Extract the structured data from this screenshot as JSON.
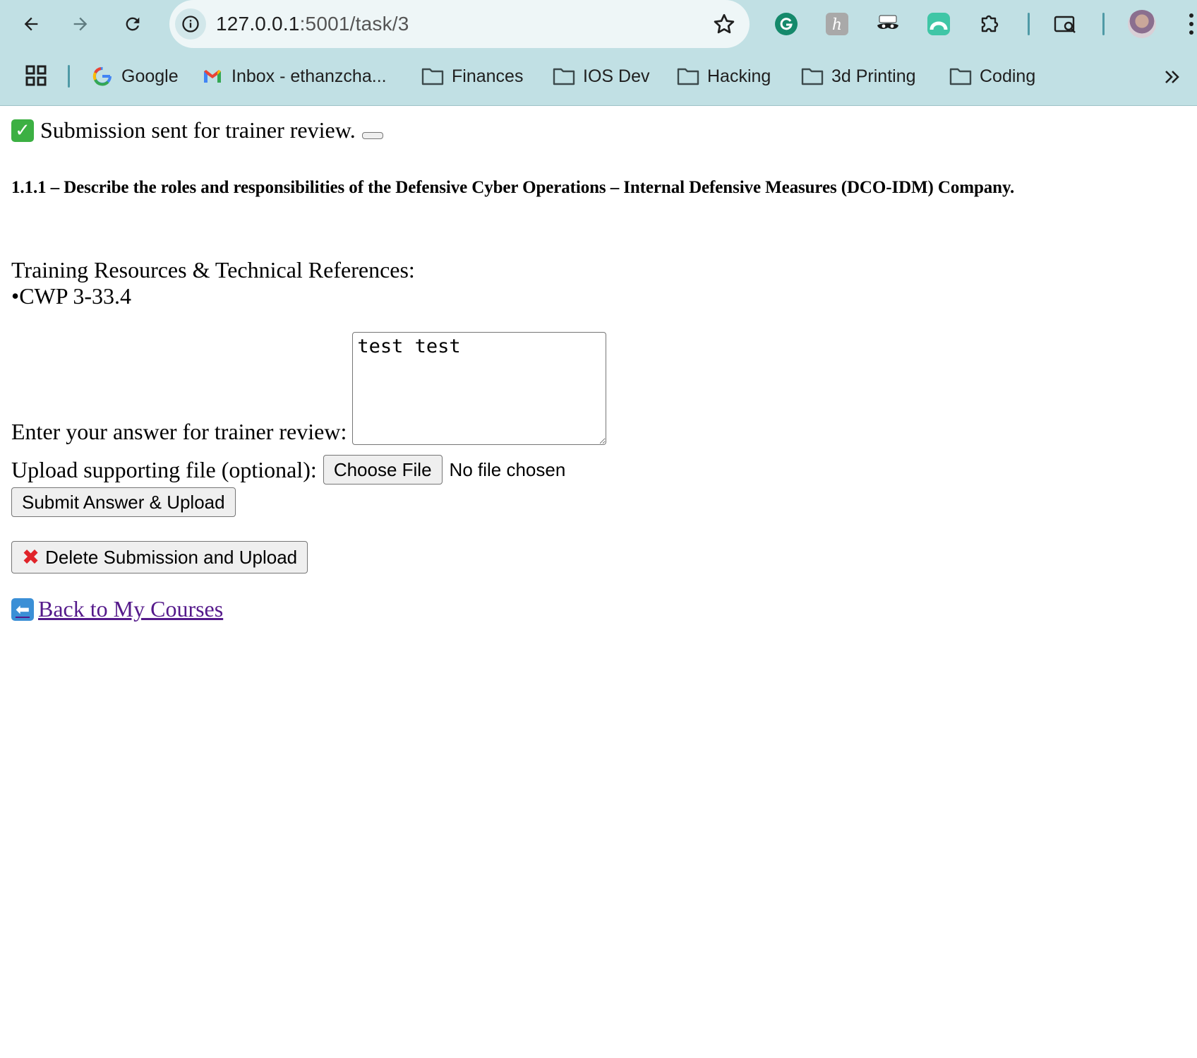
{
  "browser": {
    "url_host": "127.0.0.1",
    "url_path": ":5001/task/3",
    "bookmarks": [
      {
        "label": "Google",
        "icon": "google-icon"
      },
      {
        "label": "Inbox  - ethanzcha...",
        "icon": "gmail-icon"
      },
      {
        "label": "Finances",
        "icon": "folder-icon"
      },
      {
        "label": "IOS Dev",
        "icon": "folder-icon"
      },
      {
        "label": "Hacking",
        "icon": "folder-icon"
      },
      {
        "label": "3d Printing",
        "icon": "folder-icon"
      },
      {
        "label": "Coding",
        "icon": "folder-icon"
      }
    ],
    "extensions": [
      "grammarly-icon",
      "honey-icon",
      "mask-icon",
      "arc-icon",
      "puzzle-icon",
      "search-tab-icon"
    ]
  },
  "flash": {
    "icon": "check-emoji",
    "message": "Submission sent for trainer review."
  },
  "task": {
    "title": "1.1.1 – Describe the roles and responsibilities of the Defensive Cyber Operations – Internal Defensive Measures (DCO-IDM) Company.",
    "resources_heading": "Training Resources & Technical References:",
    "resources": [
      "•CWP 3-33.4"
    ]
  },
  "form": {
    "answer_label": "Enter your answer for trainer review:",
    "answer_value": "test test",
    "upload_label": "Upload supporting file (optional):",
    "choose_file_label": "Choose File",
    "file_status": "No file chosen",
    "submit_label": "Submit Answer & Upload",
    "delete_label": "Delete Submission and Upload"
  },
  "back_link": {
    "label": "Back to My Courses"
  },
  "colors": {
    "chrome": "#c1e0e4",
    "link_visited": "#551a8b",
    "check_green": "#3cb043",
    "x_red": "#e0242a"
  }
}
